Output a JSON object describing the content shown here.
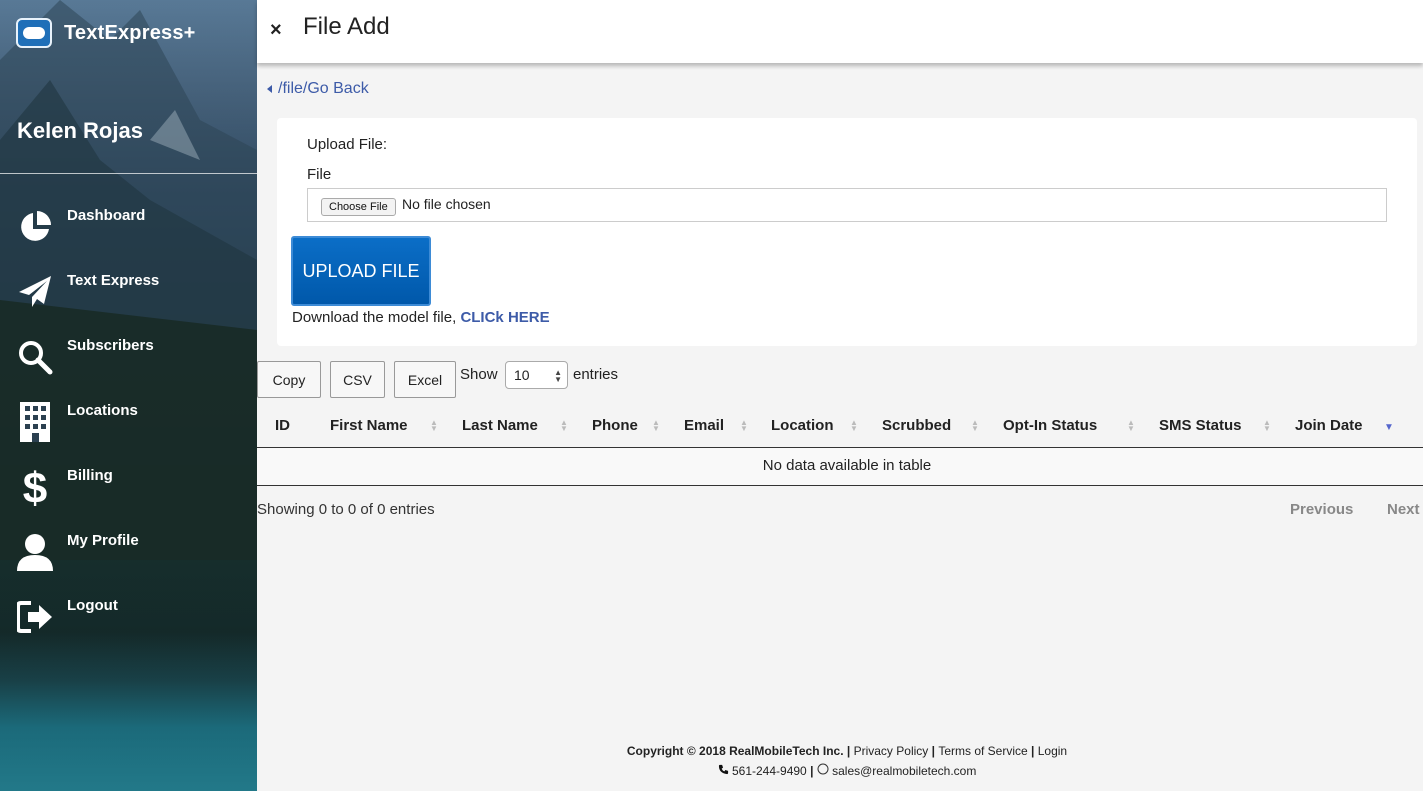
{
  "sidebar": {
    "brand": "TextExpress+",
    "user_name": "Kelen Rojas",
    "items": [
      {
        "label": "Dashboard"
      },
      {
        "label": "Text Express"
      },
      {
        "label": "Subscribers"
      },
      {
        "label": "Locations"
      },
      {
        "label": "Billing"
      },
      {
        "label": "My Profile"
      },
      {
        "label": "Logout"
      }
    ]
  },
  "header": {
    "close": "×",
    "title": "File Add"
  },
  "breadcrumb": "/file/Go Back",
  "upload": {
    "title": "Upload File:",
    "file_label": "File",
    "choose_label": "Choose File",
    "no_file": "No file chosen",
    "button": "UPLOAD FILE",
    "download_text": "Download the model file, ",
    "download_link": "CLICk HERE"
  },
  "controls": {
    "copy": "Copy",
    "csv": "CSV",
    "excel": "Excel",
    "show": "Show",
    "entries_value": "10",
    "entries": "entries"
  },
  "table": {
    "columns": [
      "ID",
      "First Name",
      "Last Name",
      "Phone",
      "Email",
      "Location",
      "Scrubbed",
      "Opt-In Status",
      "SMS Status",
      "Join Date"
    ],
    "empty": "No data available in table",
    "showing": "Showing 0 to 0 of 0 entries",
    "previous": "Previous",
    "next": "Next"
  },
  "footer": {
    "copyright": "Copyright © 2018 RealMobileTech Inc.",
    "privacy": "Privacy Policy",
    "terms": "Terms of Service",
    "login": "Login",
    "phone": "561-244-9490",
    "email": "sales@realmobiletech.com"
  },
  "colors": {
    "accent": "#3d5ba8",
    "upload_button": "#0b6ec7",
    "sort_active": "#5566cc"
  }
}
